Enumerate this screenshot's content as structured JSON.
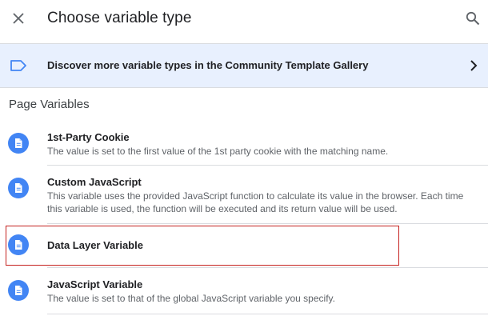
{
  "header": {
    "title": "Choose variable type"
  },
  "banner": {
    "text": "Discover more variable types in the Community Template Gallery"
  },
  "section": {
    "title": "Page Variables"
  },
  "items": [
    {
      "title": "1st-Party Cookie",
      "description": "The value is set to the first value of the 1st party cookie with the matching name."
    },
    {
      "title": "Custom JavaScript",
      "description": "This variable uses the provided JavaScript function to calculate its value in the browser. Each time this variable is used, the function will be executed and its return value will be used."
    },
    {
      "title": "Data Layer Variable",
      "description": ""
    },
    {
      "title": "JavaScript Variable",
      "description": "The value is set to that of the global JavaScript variable you specify."
    }
  ],
  "colors": {
    "accent": "#4285f4",
    "banner_bg": "#e8f0fe",
    "highlight": "#c5221f"
  },
  "icons": {
    "close": "close-icon",
    "search": "search-icon",
    "banner": "label-tag-icon",
    "chevron": "chevron-right-icon",
    "item": "document-icon"
  }
}
